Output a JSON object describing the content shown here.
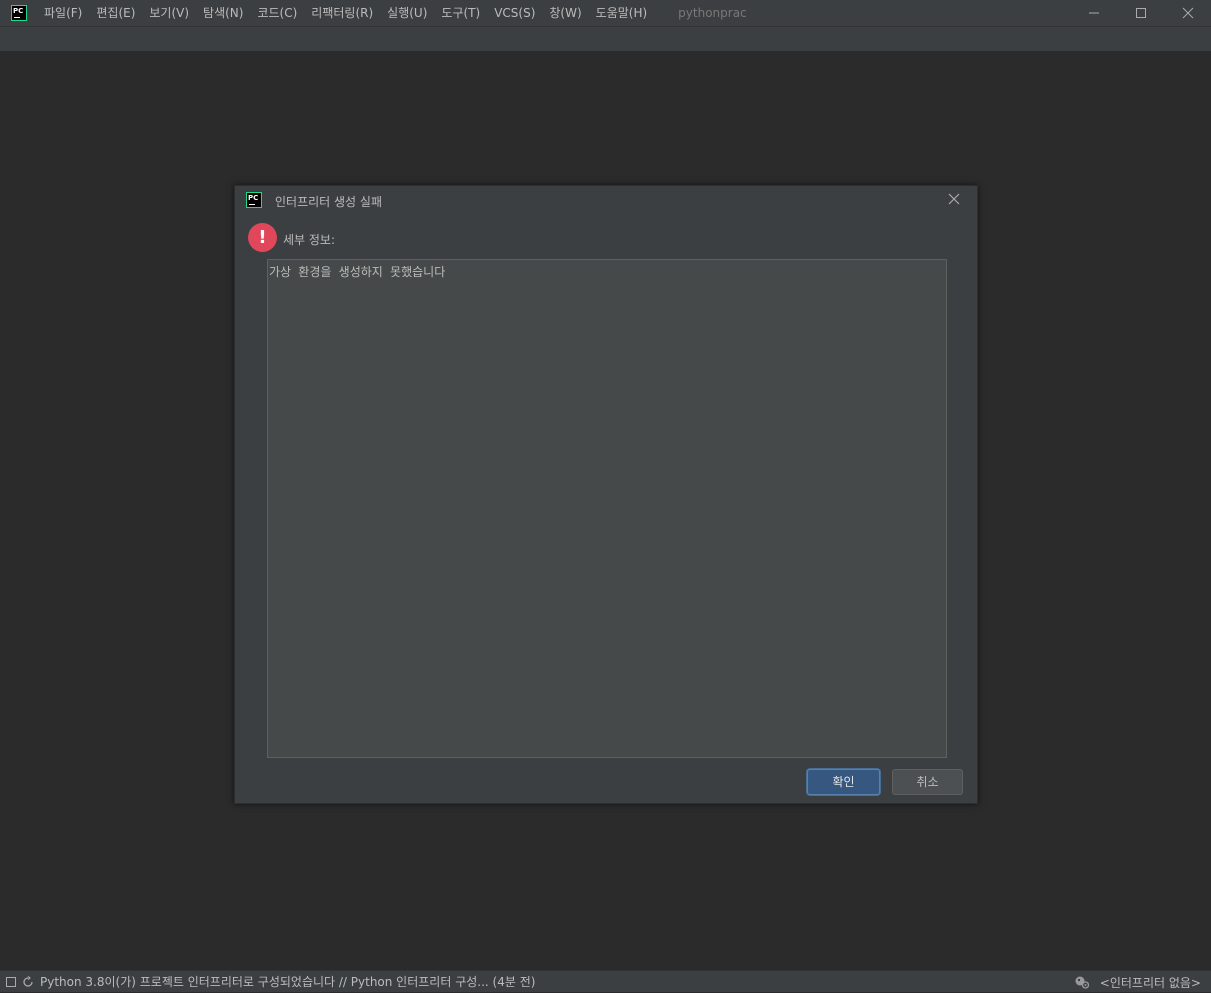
{
  "window": {
    "project_name": "pythonprac",
    "logo_text": "PC"
  },
  "menu": [
    {
      "label": "파일(F)"
    },
    {
      "label": "편집(E)"
    },
    {
      "label": "보기(V)"
    },
    {
      "label": "탐색(N)"
    },
    {
      "label": "코드(C)"
    },
    {
      "label": "리팩터링(R)"
    },
    {
      "label": "실행(U)"
    },
    {
      "label": "도구(T)"
    },
    {
      "label": "VCS(S)"
    },
    {
      "label": "창(W)"
    },
    {
      "label": "도움말(H)"
    }
  ],
  "dialog": {
    "title": "인터프리터 생성 실패",
    "detail_label": "세부 정보:",
    "detail_text": "가상 환경을 생성하지 못했습니다",
    "ok_label": "확인",
    "cancel_label": "취소"
  },
  "statusbar": {
    "message": "Python 3.8이(가) 프로젝트 인터프리터로 구성되었습니다 // Python 인터프리터 구성... (4분 전)",
    "interpreter": "<인터프리터 없음>"
  },
  "colors": {
    "background": "#2b2b2b",
    "panel": "#3c3f41",
    "accent_button": "#365880",
    "error": "#e0475a"
  },
  "icons": [
    "app-logo-icon",
    "minimize-icon",
    "maximize-icon",
    "close-icon",
    "error-icon",
    "spinner-icon",
    "layout-icon",
    "inspector-icon"
  ]
}
